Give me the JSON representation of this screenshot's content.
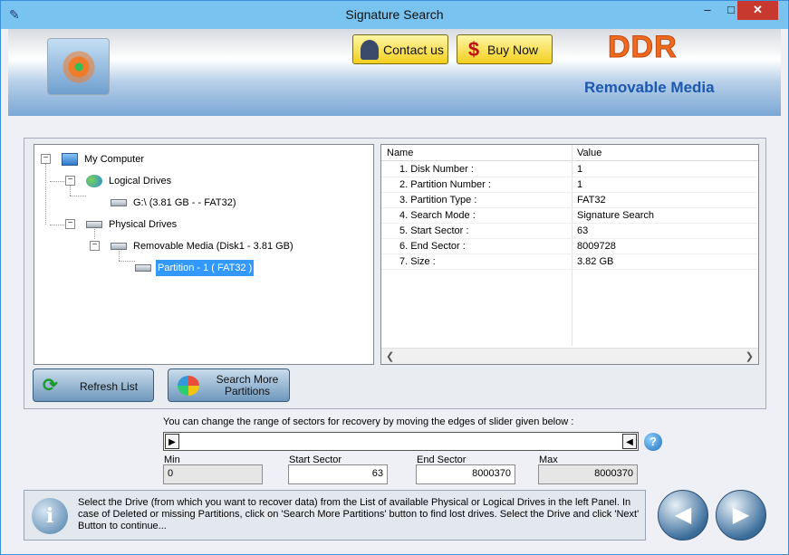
{
  "window": {
    "title": "Signature Search"
  },
  "header": {
    "contact_label": "Contact us",
    "buy_label": "Buy Now",
    "brand": "DDR",
    "subtitle": "Removable Media"
  },
  "tree": {
    "root": "My Computer",
    "logical": "Logical Drives",
    "logical_drive": "G:\\ (3.81 GB -  - FAT32)",
    "physical": "Physical Drives",
    "removable": "Removable Media (Disk1 - 3.81 GB)",
    "partition": "Partition - 1 ( FAT32 )"
  },
  "properties": {
    "headers": [
      "Name",
      "Value"
    ],
    "rows": [
      {
        "name": "1. Disk Number :",
        "value": "1"
      },
      {
        "name": "2. Partition Number :",
        "value": "1"
      },
      {
        "name": "3. Partition Type :",
        "value": "FAT32"
      },
      {
        "name": "4. Search Mode :",
        "value": "Signature Search"
      },
      {
        "name": "5. Start Sector :",
        "value": "63"
      },
      {
        "name": "6. End Sector :",
        "value": "8009728"
      },
      {
        "name": "7. Size :",
        "value": "3.82 GB"
      }
    ]
  },
  "buttons": {
    "refresh": "Refresh List",
    "search_more": "Search More Partitions"
  },
  "range": {
    "note": "You can change the range of sectors for recovery by moving the edges of slider given below :",
    "min_label": "Min",
    "min_value": "0",
    "start_label": "Start Sector",
    "start_value": "63",
    "end_label": "End Sector",
    "end_value": "8000370",
    "max_label": "Max",
    "max_value": "8000370"
  },
  "info": {
    "text": "Select the Drive (from which you want to recover data) from the List of available Physical or Logical Drives in the left Panel. In case of Deleted or missing Partitions, click on 'Search More Partitions' button to find lost drives. Select the Drive and click 'Next' Button to continue..."
  },
  "icons": {
    "app": "wrench-icon",
    "help": "help-icon",
    "info": "info-icon",
    "back": "back-arrow-icon",
    "next": "next-arrow-icon"
  }
}
